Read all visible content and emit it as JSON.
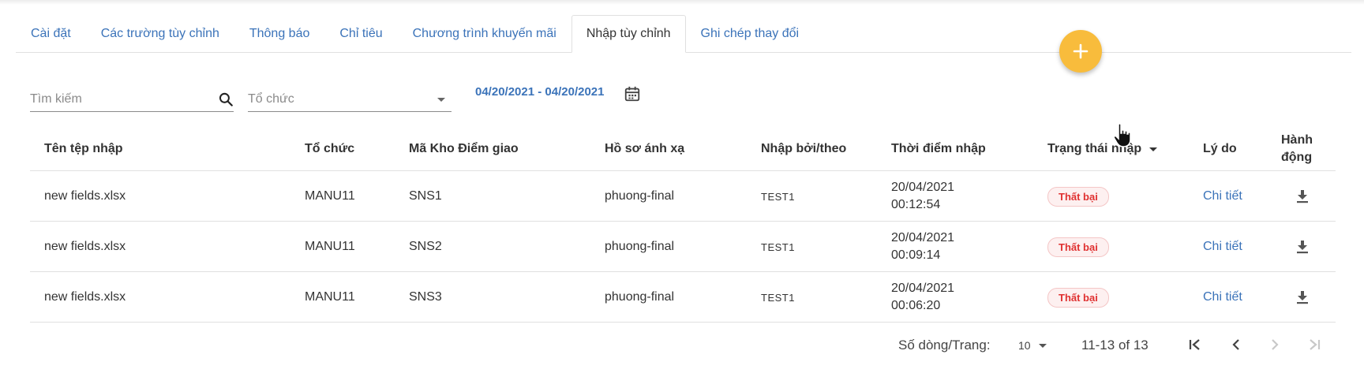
{
  "tabs": [
    {
      "label": "Cài đặt"
    },
    {
      "label": "Các trường tùy chỉnh"
    },
    {
      "label": "Thông báo"
    },
    {
      "label": "Chỉ tiêu"
    },
    {
      "label": "Chương trình khuyến mãi"
    },
    {
      "label": "Nhập tùy chỉnh",
      "active": true
    },
    {
      "label": "Ghi chép thay đổi"
    }
  ],
  "filters": {
    "search_placeholder": "Tìm kiếm",
    "org_placeholder": "Tổ chức",
    "date_range": "04/20/2021 - 04/20/2021"
  },
  "table": {
    "headers": {
      "file": "Tên tệp nhập",
      "org": "Tổ chức",
      "code": "Mã Kho Điểm giao",
      "profile": "Hồ sơ ánh xạ",
      "by": "Nhập bởi/theo",
      "time": "Thời điểm nhập",
      "status": "Trạng thái nhập",
      "reason": "Lý do",
      "action_line1": "Hành",
      "action_line2": "động"
    },
    "rows": [
      {
        "file": "new fields.xlsx",
        "org": "MANU11",
        "code": "SNS1",
        "profile": "phuong-final",
        "by": "TEST1",
        "date": "20/04/2021",
        "time": "00:12:54",
        "status": "Thất bại",
        "reason": "Chi tiết"
      },
      {
        "file": "new fields.xlsx",
        "org": "MANU11",
        "code": "SNS2",
        "profile": "phuong-final",
        "by": "TEST1",
        "date": "20/04/2021",
        "time": "00:09:14",
        "status": "Thất bại",
        "reason": "Chi tiết"
      },
      {
        "file": "new fields.xlsx",
        "org": "MANU11",
        "code": "SNS3",
        "profile": "phuong-final",
        "by": "TEST1",
        "date": "20/04/2021",
        "time": "00:06:20",
        "status": "Thất bại",
        "reason": "Chi tiết"
      }
    ]
  },
  "pagination": {
    "rows_per_page_label": "Số dòng/Trang:",
    "rows_per_page": "10",
    "range": "11-13 of 13"
  },
  "colors": {
    "accent": "#3b73b9",
    "fab": "#f8bc3c",
    "failed": "#e03131"
  },
  "icons": [
    "plus-icon",
    "search-icon",
    "dropdown-arrow-icon",
    "calendar-icon",
    "sort-arrow-icon",
    "download-icon",
    "first-page-icon",
    "prev-page-icon",
    "next-page-icon",
    "last-page-icon",
    "hand-cursor-icon"
  ]
}
